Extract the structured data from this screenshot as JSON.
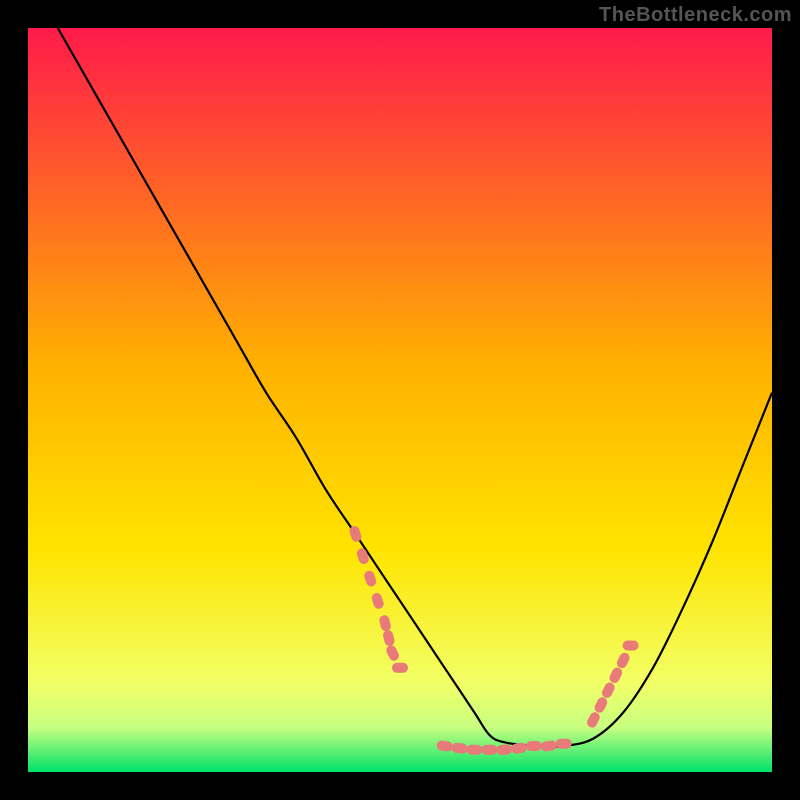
{
  "watermark": "TheBottleneck.com",
  "chart_data": {
    "type": "line",
    "title": "",
    "xlabel": "",
    "ylabel": "",
    "xlim": [
      0,
      100
    ],
    "ylim": [
      0,
      100
    ],
    "grid": false,
    "legend": false,
    "background_gradient": {
      "top_color": "#ff1a4b",
      "mid_color": "#ffd400",
      "bottom_color": "#00e26a"
    },
    "series": [
      {
        "name": "bottleneck-curve",
        "color": "#000000",
        "x": [
          4,
          8,
          12,
          16,
          20,
          24,
          28,
          32,
          36,
          40,
          44,
          48,
          52,
          56,
          60,
          62,
          64,
          68,
          72,
          76,
          80,
          84,
          88,
          92,
          96,
          100
        ],
        "y": [
          100,
          93,
          86,
          79,
          72,
          65,
          58,
          51,
          45,
          38,
          32,
          26,
          20,
          14,
          8,
          5,
          4,
          3.5,
          3.5,
          4.5,
          8,
          14,
          22,
          31,
          41,
          51
        ]
      },
      {
        "name": "marker-cluster-left",
        "type": "scatter",
        "color": "#e87a7a",
        "x": [
          44,
          45,
          46,
          47,
          48,
          48.5,
          49,
          50
        ],
        "y": [
          32,
          29,
          26,
          23,
          20,
          18,
          16,
          14
        ]
      },
      {
        "name": "marker-cluster-bottom",
        "type": "scatter",
        "color": "#e87a7a",
        "x": [
          56,
          58,
          60,
          62,
          64,
          66,
          68,
          70,
          72
        ],
        "y": [
          3.5,
          3.2,
          3,
          3,
          3,
          3.2,
          3.5,
          3.5,
          3.8
        ]
      },
      {
        "name": "marker-cluster-right",
        "type": "scatter",
        "color": "#e87a7a",
        "x": [
          76,
          77,
          78,
          79,
          80,
          81
        ],
        "y": [
          7,
          9,
          11,
          13,
          15,
          17
        ]
      }
    ]
  }
}
